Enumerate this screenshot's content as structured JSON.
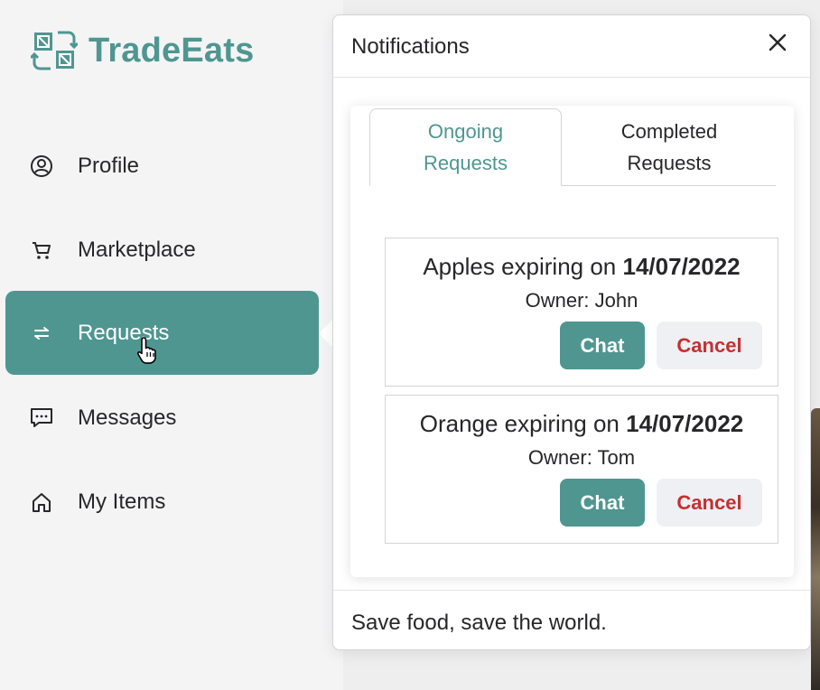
{
  "app": {
    "name": "TradeEats",
    "brand_color": "#4f9691"
  },
  "sidebar": {
    "items": [
      {
        "label": "Profile",
        "icon": "user-circle-icon",
        "active": false
      },
      {
        "label": "Marketplace",
        "icon": "cart-icon",
        "active": false
      },
      {
        "label": "Requests",
        "icon": "swap-arrows-icon",
        "active": true
      },
      {
        "label": "Messages",
        "icon": "chat-bubble-icon",
        "active": false
      },
      {
        "label": "My Items",
        "icon": "home-icon",
        "active": false
      }
    ]
  },
  "notifications": {
    "title": "Notifications",
    "close_icon": "close-icon",
    "tabs": [
      {
        "line1": "Ongoing",
        "line2": "Requests",
        "active": true
      },
      {
        "line1": "Completed",
        "line2": "Requests",
        "active": false
      }
    ],
    "requests": [
      {
        "item_prefix": "Apples expiring on",
        "date": "14/07/2022",
        "owner": "Owner: John",
        "chat_label": "Chat",
        "cancel_label": "Cancel"
      },
      {
        "item_prefix": "Orange expiring on",
        "date": "14/07/2022",
        "owner": "Owner: Tom",
        "chat_label": "Chat",
        "cancel_label": "Cancel"
      }
    ],
    "footer": "Save food, save the world."
  },
  "colors": {
    "accent": "#4f9691",
    "cancel_text": "#c53030",
    "cancel_bg": "#eef0f4"
  }
}
